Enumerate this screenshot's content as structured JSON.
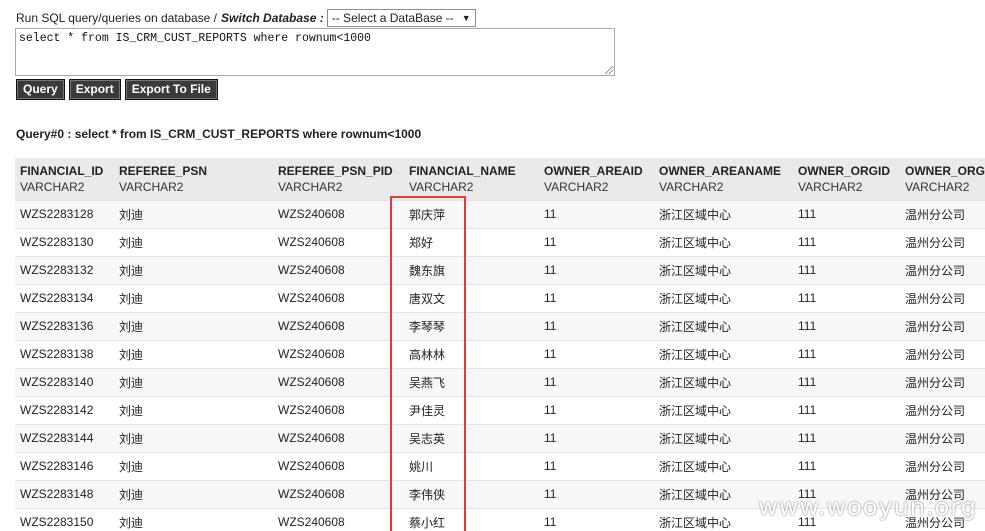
{
  "header": {
    "run_label": "Run SQL query/queries on database /",
    "switch_label": "Switch Database :",
    "db_select": "-- Select a DataBase --"
  },
  "query_input": {
    "value": "select * from IS_CRM_CUST_REPORTS where rownum<1000"
  },
  "buttons": {
    "query": "Query",
    "export": "Export",
    "export_to_file": "Export To File"
  },
  "result_title": "Query#0 : select * from IS_CRM_CUST_REPORTS where rownum<1000",
  "table": {
    "columns": [
      {
        "name": "FINANCIAL_ID",
        "type": "VARCHAR2"
      },
      {
        "name": "REFEREE_PSN",
        "type": "VARCHAR2"
      },
      {
        "name": "REFEREE_PSN_PID",
        "type": "VARCHAR2"
      },
      {
        "name": "FINANCIAL_NAME",
        "type": "VARCHAR2"
      },
      {
        "name": "OWNER_AREAID",
        "type": "VARCHAR2"
      },
      {
        "name": "OWNER_AREANAME",
        "type": "VARCHAR2"
      },
      {
        "name": "OWNER_ORGID",
        "type": "VARCHAR2"
      },
      {
        "name": "OWNER_ORG",
        "type": "VARCHAR2"
      }
    ],
    "rows": [
      [
        "WZS2283128",
        "刘迪",
        "WZS240608",
        "郭庆萍",
        "11",
        "浙江区域中心",
        "111",
        "温州分公司"
      ],
      [
        "WZS2283130",
        "刘迪",
        "WZS240608",
        "郑好",
        "11",
        "浙江区域中心",
        "111",
        "温州分公司"
      ],
      [
        "WZS2283132",
        "刘迪",
        "WZS240608",
        "魏东旗",
        "11",
        "浙江区域中心",
        "111",
        "温州分公司"
      ],
      [
        "WZS2283134",
        "刘迪",
        "WZS240608",
        "唐双文",
        "11",
        "浙江区域中心",
        "111",
        "温州分公司"
      ],
      [
        "WZS2283136",
        "刘迪",
        "WZS240608",
        "李琴琴",
        "11",
        "浙江区域中心",
        "111",
        "温州分公司"
      ],
      [
        "WZS2283138",
        "刘迪",
        "WZS240608",
        "高林林",
        "11",
        "浙江区域中心",
        "111",
        "温州分公司"
      ],
      [
        "WZS2283140",
        "刘迪",
        "WZS240608",
        "吴燕飞",
        "11",
        "浙江区域中心",
        "111",
        "温州分公司"
      ],
      [
        "WZS2283142",
        "刘迪",
        "WZS240608",
        "尹佳灵",
        "11",
        "浙江区域中心",
        "111",
        "温州分公司"
      ],
      [
        "WZS2283144",
        "刘迪",
        "WZS240608",
        "吴志英",
        "11",
        "浙江区域中心",
        "111",
        "温州分公司"
      ],
      [
        "WZS2283146",
        "刘迪",
        "WZS240608",
        "姚川",
        "11",
        "浙江区域中心",
        "111",
        "温州分公司"
      ],
      [
        "WZS2283148",
        "刘迪",
        "WZS240608",
        "李伟侠",
        "11",
        "浙江区域中心",
        "111",
        "温州分公司"
      ],
      [
        "WZS2283150",
        "刘迪",
        "WZS240608",
        "蔡小红",
        "11",
        "浙江区域中心",
        "111",
        "温州分公司"
      ]
    ]
  },
  "watermark": "www.wooyun.org",
  "colors": {
    "highlight": "#e53935",
    "button_bg": "#3a3a3a",
    "header_bg": "#eaeaea"
  }
}
